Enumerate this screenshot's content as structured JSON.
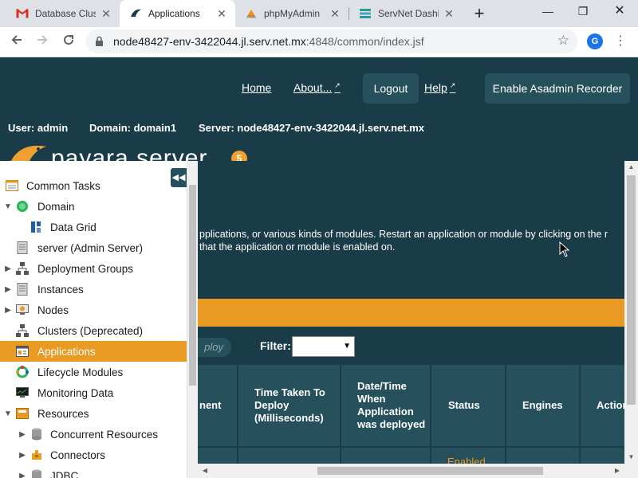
{
  "browser": {
    "tabs": [
      {
        "title": "Database Clust",
        "icon": "gmail-icon"
      },
      {
        "title": "Applications",
        "icon": "payara-fish-icon"
      },
      {
        "title": "phpMyAdmin",
        "icon": "phpmyadmin-icon"
      },
      {
        "title": "ServNet Dashb",
        "icon": "grid-icon"
      }
    ],
    "url_host": "node48427-env-3422044.jl.serv.net.mx",
    "url_rest": ":4848/common/index.jsf",
    "profile_initial": "G"
  },
  "header": {
    "links": {
      "home": "Home",
      "about": "About...",
      "help": "Help"
    },
    "logout_label": "Logout",
    "recorder_label": "Enable Asadmin Recorder",
    "user": "User: admin",
    "domain": "Domain: domain1",
    "server": "Server: node48427-env-3422044.jl.serv.net.mx",
    "brand": "payara server",
    "brand_badge": "5"
  },
  "tree": {
    "items": [
      {
        "label": "Common Tasks",
        "icon": "tasks-icon"
      },
      {
        "label": "Domain",
        "icon": "domain-icon"
      },
      {
        "label": "Data Grid",
        "icon": "data-grid-icon"
      },
      {
        "label": "server (Admin Server)",
        "icon": "server-icon"
      },
      {
        "label": "Deployment Groups",
        "icon": "deployment-groups-icon"
      },
      {
        "label": "Instances",
        "icon": "instances-icon"
      },
      {
        "label": "Nodes",
        "icon": "nodes-icon"
      },
      {
        "label": "Clusters (Deprecated)",
        "icon": "clusters-icon"
      },
      {
        "label": "Applications",
        "icon": "applications-icon"
      },
      {
        "label": "Lifecycle Modules",
        "icon": "lifecycle-icon"
      },
      {
        "label": "Monitoring Data",
        "icon": "monitoring-icon"
      },
      {
        "label": "Resources",
        "icon": "resources-icon"
      },
      {
        "label": "Concurrent Resources",
        "icon": "database-icon"
      },
      {
        "label": "Connectors",
        "icon": "connector-icon"
      },
      {
        "label": "JDBC",
        "icon": "database-icon"
      }
    ]
  },
  "main": {
    "help_line1": "pplications, or various kinds of modules. Restart an application or module by clicking on the r",
    "help_line2": "that the application or module is enabled on.",
    "undeploy_label": "ploy",
    "filter_label": "Filter:",
    "columns": [
      "nent",
      "Time Taken To Deploy (Milliseconds)",
      "Date/Time When Application was deployed",
      "Status",
      "Engines",
      "Action"
    ],
    "row_status": "Enabled"
  },
  "colors": {
    "header_bg": "#193c48",
    "accent_orange": "#e89a22",
    "panel_teal": "#27505d"
  }
}
